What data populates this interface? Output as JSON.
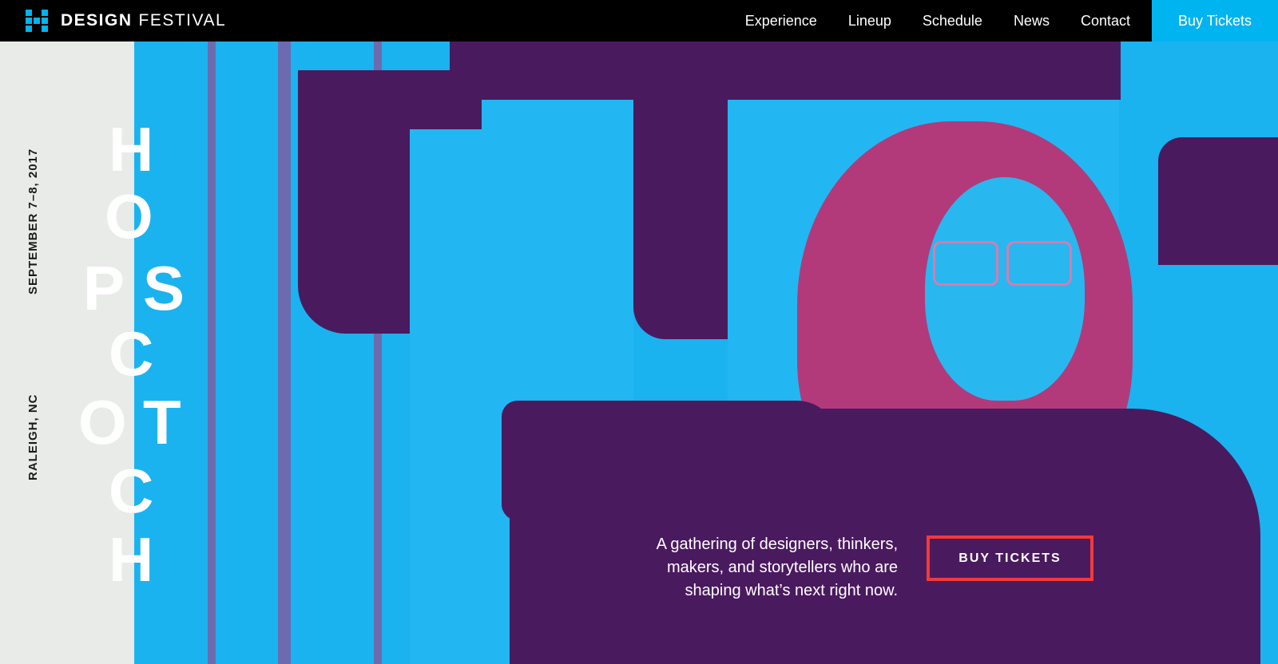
{
  "brand": {
    "name_bold": "DESIGN",
    "name_light": "FESTIVAL",
    "icon": "grid-logo-icon"
  },
  "nav": {
    "links": [
      "Experience",
      "Lineup",
      "Schedule",
      "News",
      "Contact"
    ],
    "buy_label": "Buy Tickets"
  },
  "sidebar": {
    "date": "SEPTEMBER 7–8, 2017",
    "location": "RALEIGH, NC"
  },
  "hero": {
    "wordmark": [
      "H",
      "O",
      "P",
      "S",
      "C",
      "O",
      "T",
      "C",
      "H"
    ],
    "tagline": "A gathering of designers, thinkers, makers, and storytellers who are shaping what’s next right now.",
    "cta_label": "BUY TICKETS"
  },
  "colors": {
    "accent_blue": "#00b4f0",
    "purple": "#4a1a5f",
    "cta_border": "#f23a3a",
    "sidebar_bg": "#e9ebe9"
  }
}
